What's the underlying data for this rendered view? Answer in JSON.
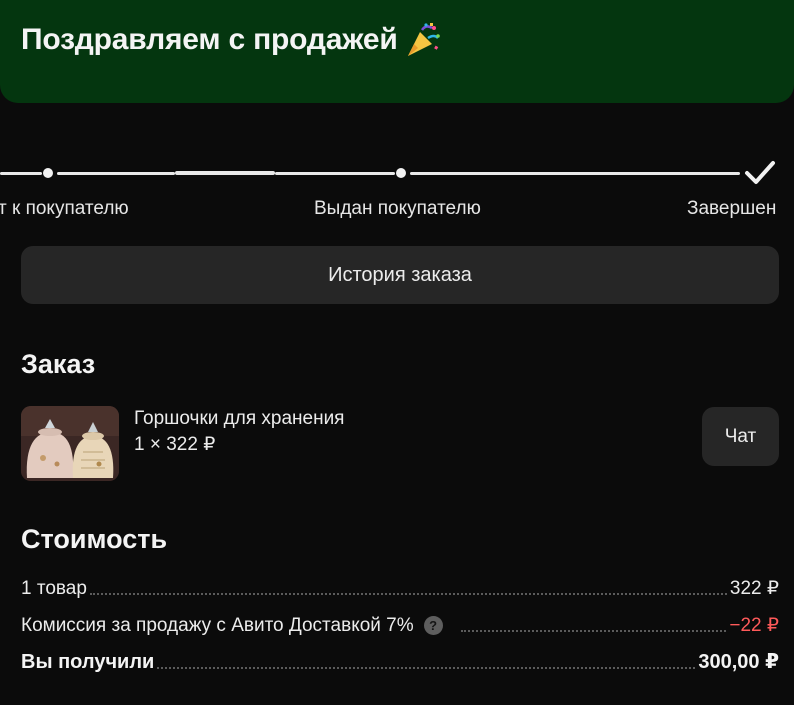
{
  "banner": {
    "title": "Поздравляем с продажей",
    "icon": "party-popper-icon"
  },
  "progress": {
    "steps": [
      {
        "label": "т к покупателю"
      },
      {
        "label": "Выдан покупателю"
      },
      {
        "label": "Завершен"
      }
    ]
  },
  "history_button": {
    "label": "История заказа"
  },
  "order": {
    "title": "Заказ",
    "item": {
      "name": "Горшочки для хранения",
      "qty_price": "1 × 322 ₽"
    },
    "chat_label": "Чат"
  },
  "cost": {
    "title": "Стоимость",
    "rows": [
      {
        "label": "1 товар",
        "value": "322 ₽"
      },
      {
        "label": "Комиссия за продажу с Авито Доставкой 7%",
        "value": "−22 ₽"
      },
      {
        "label": "Вы получили",
        "value": "300,00 ₽"
      }
    ]
  },
  "colors": {
    "banner": "#04360f",
    "background": "#0b0b0b",
    "button": "#262626",
    "negative": "#ff5a5a"
  }
}
